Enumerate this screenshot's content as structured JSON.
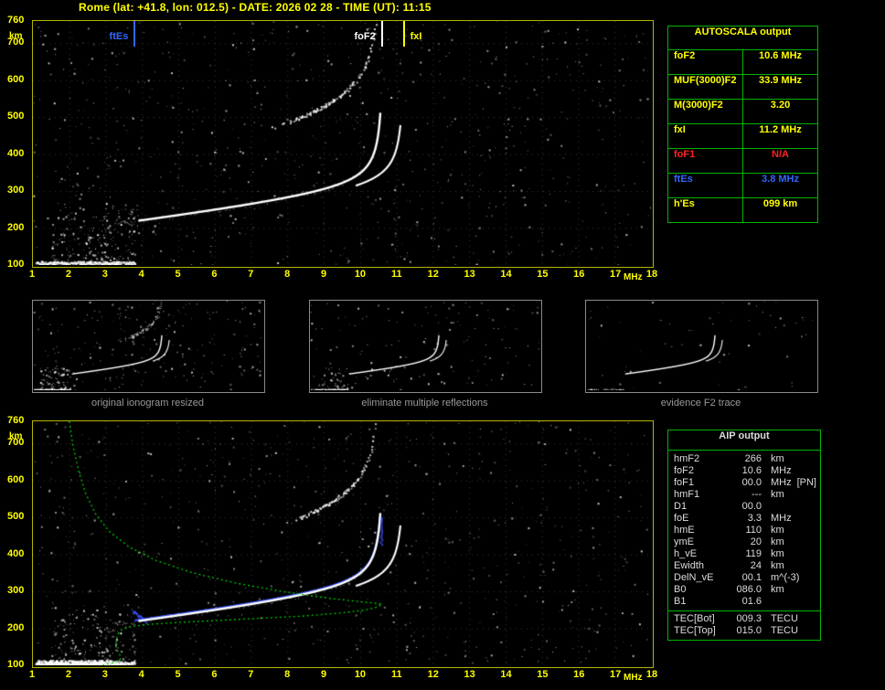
{
  "header": {
    "title": "Rome (lat: +41.8, lon: 012.5) - DATE: 2026 02 28 - TIME (UT): 11:15"
  },
  "colors": {
    "axis_yellow": "#ffff00",
    "plot_border": "#b5b500",
    "table_border": "#00b400",
    "trace_white": "#ffffff",
    "profile_green": "#00cc00",
    "trace_blue": "#3a50ff",
    "marker_blue": "#3366ff",
    "value_red": "#ff2222",
    "aip_text": "#dcdcdc",
    "caption_gray": "#9a9a9a"
  },
  "ionogram_axes": {
    "x_min": 1,
    "x_max": 18,
    "y_min": 100,
    "y_max": 760,
    "x_ticks": [
      "1",
      "2",
      "3",
      "4",
      "5",
      "6",
      "7",
      "8",
      "9",
      "10",
      "11",
      "12",
      "13",
      "14",
      "15",
      "16",
      "17",
      "18"
    ],
    "y_ticks": [
      "760",
      "700",
      "600",
      "500",
      "400",
      "300",
      "200",
      "100"
    ],
    "x_unit": "MHz",
    "y_unit": "km"
  },
  "top_plot": {
    "markers": [
      {
        "label": "ftEs",
        "freq": 3.8,
        "color": "#3366ff"
      },
      {
        "label": "foF2",
        "freq": 10.6,
        "color": "#ffffff"
      },
      {
        "label": "fxI",
        "freq": 11.2,
        "color": "#ffff00"
      }
    ]
  },
  "autoscala": {
    "title": "AUTOSCALA output",
    "rows": [
      {
        "label": "foF2",
        "value": "10.6 MHz",
        "color": "#ffff00"
      },
      {
        "label": "MUF(3000)F2",
        "value": "33.9 MHz",
        "color": "#ffff00"
      },
      {
        "label": "M(3000)F2",
        "value": "3.20",
        "color": "#ffff00"
      },
      {
        "label": "fxI",
        "value": "11.2 MHz",
        "color": "#ffff00"
      },
      {
        "label": "foF1",
        "value": "N/A",
        "color": "#ff2222"
      },
      {
        "label": "ftEs",
        "value": "3.8 MHz",
        "color": "#3366ff"
      },
      {
        "label": "h'Es",
        "value": "099  km",
        "color": "#ffff00"
      }
    ]
  },
  "thumbnails": [
    {
      "caption": "original ionogram resized"
    },
    {
      "caption": "eliminate multiple reflections"
    },
    {
      "caption": "evidence F2 trace"
    }
  ],
  "aip": {
    "title": "AIP output",
    "rows": [
      {
        "label": "hmF2",
        "value": "266",
        "unit": "km"
      },
      {
        "label": "foF2",
        "value": "10.6",
        "unit": "MHz"
      },
      {
        "label": "foF1",
        "value": "00.0",
        "unit": "MHz",
        "extra": "[PN]"
      },
      {
        "label": "hmF1",
        "value": "---",
        "unit": "km"
      },
      {
        "label": "D1",
        "value": "00.0",
        "unit": ""
      },
      {
        "label": "foE",
        "value": "3.3",
        "unit": "MHz"
      },
      {
        "label": "hmE",
        "value": "110",
        "unit": "km"
      },
      {
        "label": "ymE",
        "value": "20",
        "unit": "km"
      },
      {
        "label": "h_vE",
        "value": "119",
        "unit": "km"
      },
      {
        "label": "Ewidth",
        "value": "24",
        "unit": "km"
      },
      {
        "label": "DelN_vE",
        "value": "00.1",
        "unit": "m^(-3)"
      },
      {
        "label": "B0",
        "value": "086.0",
        "unit": "km"
      },
      {
        "label": "B1",
        "value": "01.6",
        "unit": ""
      }
    ],
    "tec_rows": [
      {
        "label": "TEC[Bot]",
        "value": "009.3",
        "unit": "TECU"
      },
      {
        "label": "TEC[Top]",
        "value": "015.0",
        "unit": "TECU"
      }
    ]
  },
  "traces": {
    "foF2": 10.6,
    "fxI": 11.2,
    "ftEs": 3.8,
    "foE": 3.3,
    "hmF2": 266,
    "hmE": 110,
    "hEs": 99,
    "green_profile": [
      [
        2.0,
        760
      ],
      [
        2.1,
        695
      ],
      [
        2.25,
        628
      ],
      [
        2.45,
        565
      ],
      [
        2.72,
        510
      ],
      [
        3.1,
        462
      ],
      [
        3.65,
        420
      ],
      [
        4.4,
        383
      ],
      [
        5.4,
        350
      ],
      [
        6.6,
        322
      ],
      [
        7.9,
        299
      ],
      [
        9.1,
        282
      ],
      [
        10.1,
        271
      ],
      [
        10.6,
        266
      ],
      [
        10.5,
        258
      ],
      [
        10.1,
        249
      ],
      [
        9.4,
        241
      ],
      [
        8.4,
        233
      ],
      [
        7.2,
        227
      ],
      [
        6.0,
        221
      ],
      [
        5.0,
        216
      ],
      [
        4.2,
        211
      ],
      [
        3.7,
        205
      ],
      [
        3.45,
        197
      ],
      [
        3.35,
        186
      ],
      [
        3.3,
        172
      ],
      [
        3.28,
        158
      ],
      [
        3.3,
        144
      ],
      [
        3.38,
        130
      ],
      [
        3.42,
        120
      ],
      [
        3.38,
        113
      ],
      [
        3.25,
        108
      ],
      [
        3.05,
        104
      ],
      [
        2.95,
        101
      ],
      [
        2.9,
        100
      ]
    ]
  }
}
